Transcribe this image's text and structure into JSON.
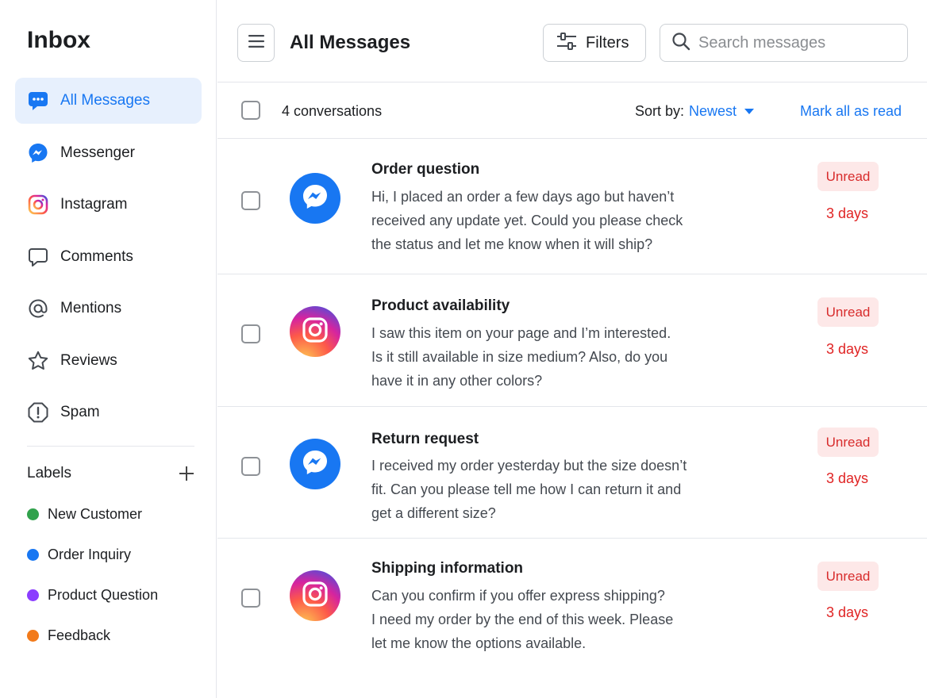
{
  "sidebar": {
    "title": "Inbox",
    "items": [
      {
        "label": "All Messages",
        "icon": "all-messages-icon",
        "active": true
      },
      {
        "label": "Messenger",
        "icon": "messenger-icon"
      },
      {
        "label": "Instagram",
        "icon": "instagram-icon"
      },
      {
        "label": "Comments",
        "icon": "comment-icon"
      },
      {
        "label": "Mentions",
        "icon": "at-icon"
      },
      {
        "label": "Reviews",
        "icon": "star-icon"
      },
      {
        "label": "Spam",
        "icon": "alert-shield-icon"
      }
    ],
    "labels_title": "Labels",
    "labels": [
      {
        "label": "New Customer",
        "color": "#31a24c"
      },
      {
        "label": "Order Inquiry",
        "color": "#1877f2"
      },
      {
        "label": "Product Question",
        "color": "#8b3dff"
      },
      {
        "label": "Feedback",
        "color": "#f27a1a"
      }
    ]
  },
  "header": {
    "title": "All Messages",
    "filters_label": "Filters",
    "search_placeholder": "Search messages"
  },
  "toolbar": {
    "count": "4 conversations",
    "sort_label": "Sort by:",
    "sort_value": "Newest",
    "mark_all": "Mark all as read"
  },
  "conversations": [
    {
      "channel": "messenger",
      "subject": "Order question",
      "preview": [
        "Hi, I placed an order a few days ago but haven’t",
        "received any update yet. Could you please check",
        "the status and let me know when it will ship?"
      ],
      "status": "Unread",
      "age": "3 days"
    },
    {
      "channel": "instagram",
      "subject": "Product availability",
      "preview": [
        "I saw this item on your page and I’m interested.",
        "Is it still available in size medium? Also, do you",
        "have it in any other colors?"
      ],
      "status": "Unread",
      "age": "3 days"
    },
    {
      "channel": "messenger",
      "subject": "Return request",
      "preview": [
        "I received my order yesterday but the size doesn’t",
        "fit. Can you please tell me how I can return it and",
        "get a different size?"
      ],
      "status": "Unread",
      "age": "3 days"
    },
    {
      "channel": "instagram",
      "subject": "Shipping information",
      "preview": [
        "Can you confirm if you offer express shipping?",
        "I need my order by the end of this week. Please",
        "let me know the options available."
      ],
      "status": "Unread",
      "age": "3 days"
    }
  ],
  "colors": {
    "accent": "#1877f2",
    "active_bg": "#e7f0fd",
    "unread_bg": "#fde8e8",
    "unread_text": "#e02424"
  }
}
